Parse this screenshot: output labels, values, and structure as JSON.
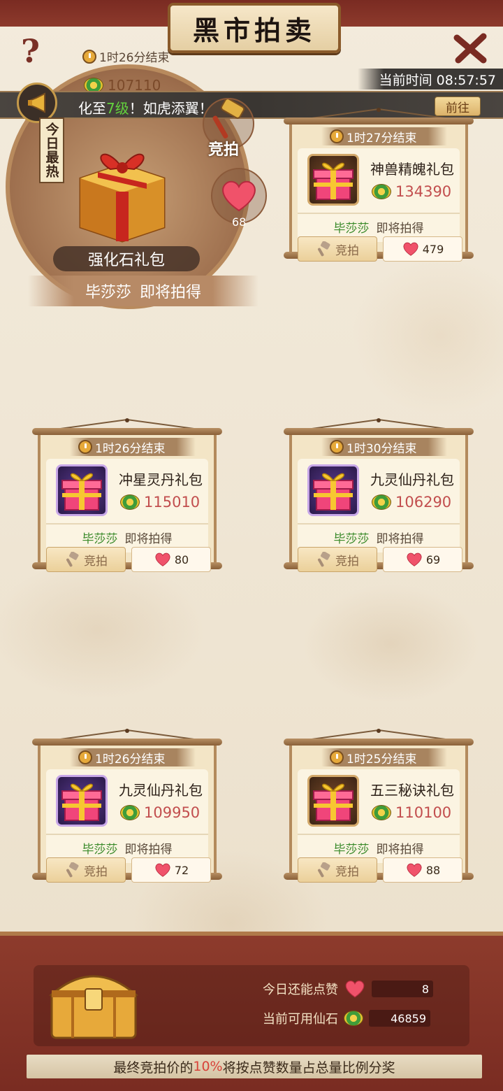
{
  "header": {
    "title": "黑市拍卖",
    "help_label": "?",
    "current_time_label": "当前时间 08:57:57"
  },
  "broadcast": {
    "text_prefix": "化至",
    "level": "7级",
    "text_suffix": "！如虎添翼！",
    "goto_label": "前往"
  },
  "hot_item": {
    "tag": "今日最热",
    "timer": "1时26分结束",
    "price": "107110",
    "name": "强化石礼包",
    "bidder": "毕莎莎",
    "status": "即将拍得",
    "bid_label": "竞拍",
    "likes": "68"
  },
  "cards": [
    {
      "timer": "1时27分结束",
      "name": "神兽精魄礼包",
      "price": "134390",
      "bidder": "毕莎莎",
      "status": "即将拍得",
      "bid_label": "竞拍",
      "likes": "479",
      "frame": "dark"
    },
    {
      "timer": "1时26分结束",
      "name": "冲星灵丹礼包",
      "price": "115010",
      "bidder": "毕莎莎",
      "status": "即将拍得",
      "bid_label": "竞拍",
      "likes": "80",
      "frame": "purple"
    },
    {
      "timer": "1时30分结束",
      "name": "九灵仙丹礼包",
      "price": "106290",
      "bidder": "毕莎莎",
      "status": "即将拍得",
      "bid_label": "竞拍",
      "likes": "69",
      "frame": "purple"
    },
    {
      "timer": "1时26分结束",
      "name": "九灵仙丹礼包",
      "price": "109950",
      "bidder": "毕莎莎",
      "status": "即将拍得",
      "bid_label": "竞拍",
      "likes": "72",
      "frame": "purple"
    },
    {
      "timer": "1时25分结束",
      "name": "五三秘诀礼包",
      "price": "110100",
      "bidder": "毕莎莎",
      "status": "即将拍得",
      "bid_label": "竞拍",
      "likes": "88",
      "frame": "dark"
    }
  ],
  "footer": {
    "likes_left_label": "今日还能点赞",
    "likes_left_value": "8",
    "stones_label": "当前可用仙石",
    "stones_value": "46859",
    "note_prefix": "最终竞拍价的",
    "note_pct": "10%",
    "note_suffix": "将按点赞数量占总量比例分奖"
  },
  "colors": {
    "accent_red": "#7a2b22",
    "price_red": "#c24e4e",
    "bidder_green": "#3a8a2a",
    "highlight_green": "#63d33d"
  }
}
